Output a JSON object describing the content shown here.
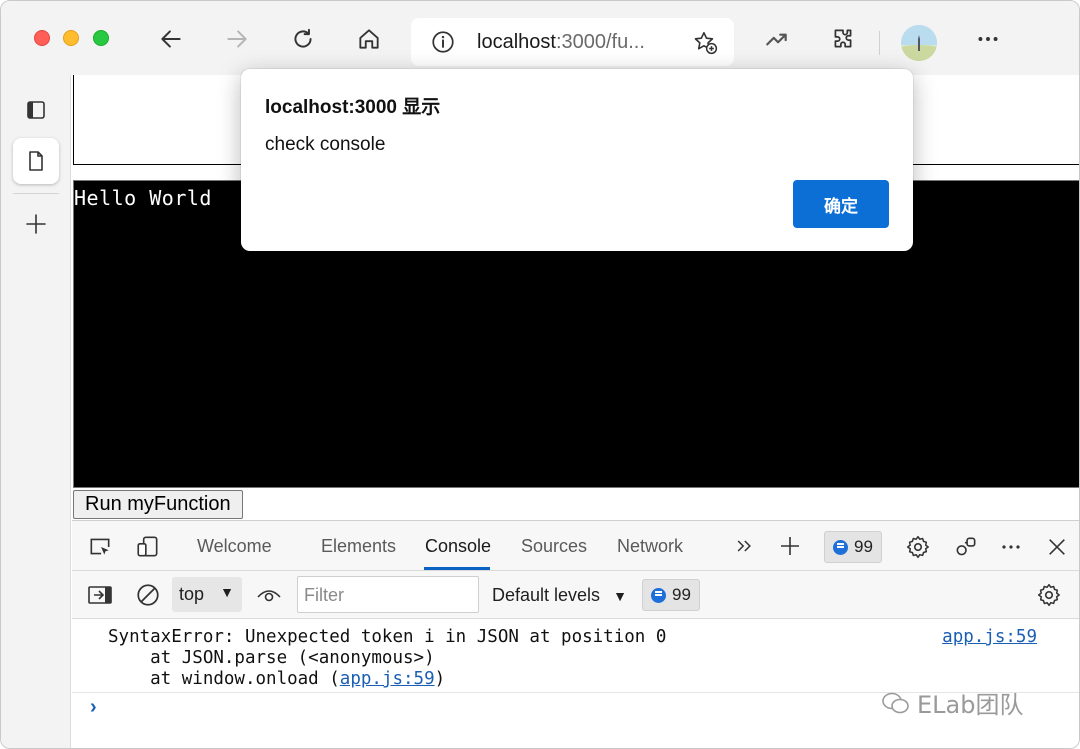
{
  "browser": {
    "url_host": "localhost",
    "url_rest": ":3000/fu...",
    "icons": [
      "back-icon",
      "forward-icon",
      "refresh-icon",
      "home-icon",
      "info-icon",
      "favorite-add-icon",
      "performance-icon",
      "extensions-icon",
      "profile-avatar",
      "more-icon"
    ]
  },
  "page": {
    "canvas_text": "Hello World",
    "run_button": "Run myFunction"
  },
  "dialog": {
    "title": "localhost:3000 显示",
    "message": "check console",
    "ok_label": "确定"
  },
  "devtools": {
    "tabs": [
      {
        "label": "Welcome"
      },
      {
        "label": "Elements"
      },
      {
        "label": "Console"
      },
      {
        "label": "Sources"
      },
      {
        "label": "Network"
      }
    ],
    "active_tab": "Console",
    "issues_count": "99",
    "context": "top",
    "filter_placeholder": "Filter",
    "levels": "Default levels",
    "messages_count": "99",
    "accent_color": "#0a62c4"
  },
  "console": {
    "error_line1": "SyntaxError: Unexpected token i in JSON at position 0",
    "error_line2": "    at JSON.parse (<anonymous>)",
    "error_line3_prefix": "    at window.onload (",
    "error_line3_link": "app.js:59",
    "error_line3_suffix": ")",
    "source_link": "app.js:59",
    "prompt": "›"
  },
  "watermark": "ELab团队"
}
